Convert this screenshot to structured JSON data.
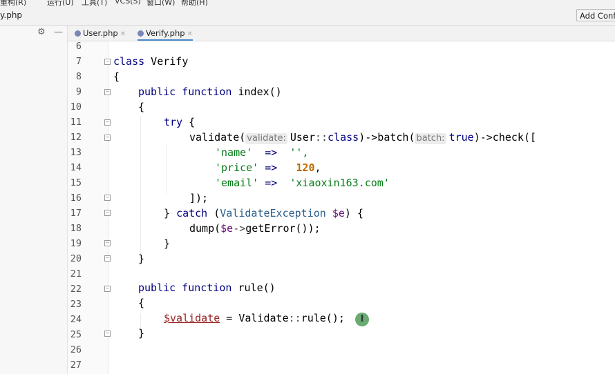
{
  "menubar": {
    "items": [
      "重构(R)",
      "运行(U)",
      "工具(T)",
      "VCS(S)",
      "窗口(W)",
      "帮助(H)"
    ]
  },
  "titlebar": {
    "file_title": "y.php",
    "add_config": "Add Confi"
  },
  "panel_tools": {
    "settings_icon": "gear-icon",
    "minimize_icon": "minimize-icon"
  },
  "tabs": [
    {
      "label": "User.php",
      "active": false
    },
    {
      "label": "Verify.php",
      "active": true
    }
  ],
  "line_numbers": [
    "6",
    "7",
    "8",
    "9",
    "10",
    "11",
    "12",
    "13",
    "14",
    "15",
    "16",
    "17",
    "18",
    "19",
    "20",
    "21",
    "22",
    "23",
    "24",
    "25",
    "26",
    "27"
  ],
  "code": {
    "l7": {
      "kw": "class",
      "name": " Verify"
    },
    "l8": "{",
    "l9": {
      "kw": "public function",
      "name": " index()"
    },
    "l10": "{",
    "l11": {
      "kw": "try",
      "rest": " {"
    },
    "l12": {
      "fn": "validate(",
      "hint1": "validate:",
      "cls": "User",
      "sep1": "::",
      "kwclass": "class",
      "mid": ")->batch(",
      "hint2": "batch:",
      "kwtrue": "true",
      "end": ")->check(["
    },
    "l13": {
      "key": "'name'",
      "arrow": "  =>  ",
      "val": "'',"
    },
    "l14": {
      "key": "'price'",
      "arrow": " =>   ",
      "num": "120",
      "tail": ","
    },
    "l15": {
      "key": "'email'",
      "arrow": " =>  ",
      "val": "'xiaoxin163.com'"
    },
    "l16": "]);",
    "l17": {
      "pre": "} ",
      "kw": "catch",
      "mid": " (",
      "exc": "ValidateException",
      "var": " $e",
      "end": ") {"
    },
    "l18": {
      "fn": "dump(",
      "var": "$e",
      "arrow": "->",
      "rest": "getError());"
    },
    "l19": "}",
    "l20": "}",
    "l22": {
      "kw": "public function",
      "name": " rule()"
    },
    "l23": "{",
    "l24": {
      "var": "$validate",
      "eq": " = Validate",
      "sep": "::",
      "rest": "rule();"
    },
    "l25": "}"
  },
  "cursor_icon": "text-cursor-icon"
}
